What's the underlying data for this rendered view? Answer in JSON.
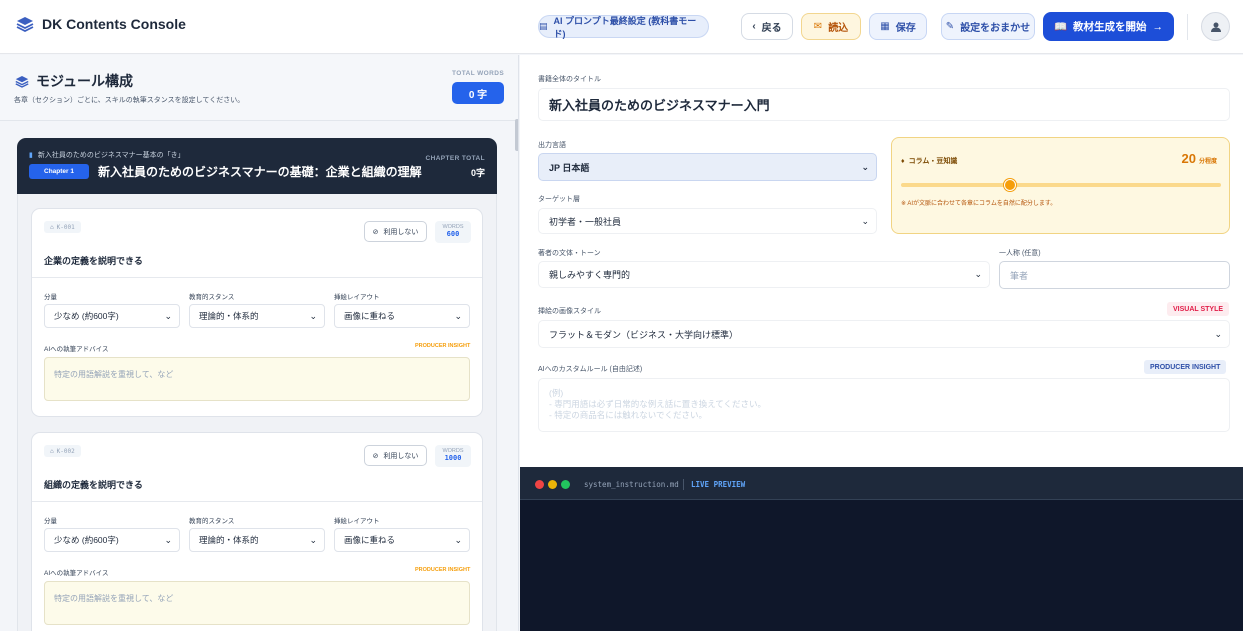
{
  "header": {
    "app_title": "DK Contents Console",
    "ai_setting": "AI プロンプト最終設定 (教科書モード)",
    "back": "戻る",
    "load": "読込",
    "save": "保存",
    "auto": "設定をおまかせ",
    "start": "教材生成を開始"
  },
  "left": {
    "title": "モジュール構成",
    "subtitle": "各章（セクション）ごとに、スキルの執筆スタンスを設定してください。",
    "total_words_label": "TOTAL WORDS",
    "total_words_value": "0 字",
    "chapter": {
      "crumb": "新入社員のためのビジネスマナー基本の「き」",
      "tag": "Chapter 1",
      "name": "新入社員のためのビジネスマナーの基礎：企業と組織の理解",
      "total_label": "CHAPTER TOTAL",
      "total_value": "0字"
    },
    "modules": [
      {
        "id": "K-001",
        "unuse": "利用しない",
        "words_label": "WORDS",
        "words": "600",
        "title": "企業の定義を説明できる",
        "amount_label": "分量",
        "amount": "少なめ (約600字)",
        "stance_label": "教育的スタンス",
        "stance": "理論的・体系的",
        "layout_label": "挿絵レイアウト",
        "layout": "画像に重ねる",
        "advice_label": "AIへの執筆アドバイス",
        "insight": "PRODUCER INSIGHT",
        "placeholder": "特定の用語解説を重視して、など"
      },
      {
        "id": "K-002",
        "unuse": "利用しない",
        "words_label": "WORDS",
        "words": "1000",
        "title": "組織の定義を説明できる",
        "amount_label": "分量",
        "amount": "少なめ (約600字)",
        "stance_label": "教育的スタンス",
        "stance": "理論的・体系的",
        "layout_label": "挿絵レイアウト",
        "layout": "画像に重ねる",
        "advice_label": "AIへの執筆アドバイス",
        "insight": "PRODUCER INSIGHT",
        "placeholder": "特定の用語解説を重視して、など"
      }
    ]
  },
  "right": {
    "book_title_label": "書籍全体のタイトル",
    "book_title": "新入社員のためのビジネスマナー入門",
    "lang_label": "出力言語",
    "lang": "JP 日本語",
    "target_label": "ターゲット層",
    "target": "初学者・一般社員",
    "tone_label": "著者の文体・トーン",
    "tone": "親しみやすく専門的",
    "person_label": "一人称 (任意)",
    "person_placeholder": "筆者",
    "column": {
      "title": "コラム・豆知識",
      "value": "20",
      "unit": "分程度",
      "note": "※ AIが文脈に合わせて各章にコラムを自然に配分します。",
      "slider_fraction": 0.34
    },
    "style_label": "挿絵の画像スタイル",
    "style_badge": "VISUAL STYLE",
    "style": "フラット＆モダン（ビジネス・大学向け標準）",
    "rule_label": "AIへのカスタムルール (自由記述)",
    "rule_badge": "PRODUCER INSIGHT",
    "rule_placeholder": "(例)\n- 専門用語は必ず日常的な例え話に置き換えてください。\n- 特定の商品名には触れないでください。"
  },
  "terminal": {
    "file": "system_instruction.md",
    "live": "LIVE PREVIEW"
  },
  "colors": {
    "accent": "#2563eb",
    "dark": "#1e293b",
    "amber": "#f59e0b"
  }
}
